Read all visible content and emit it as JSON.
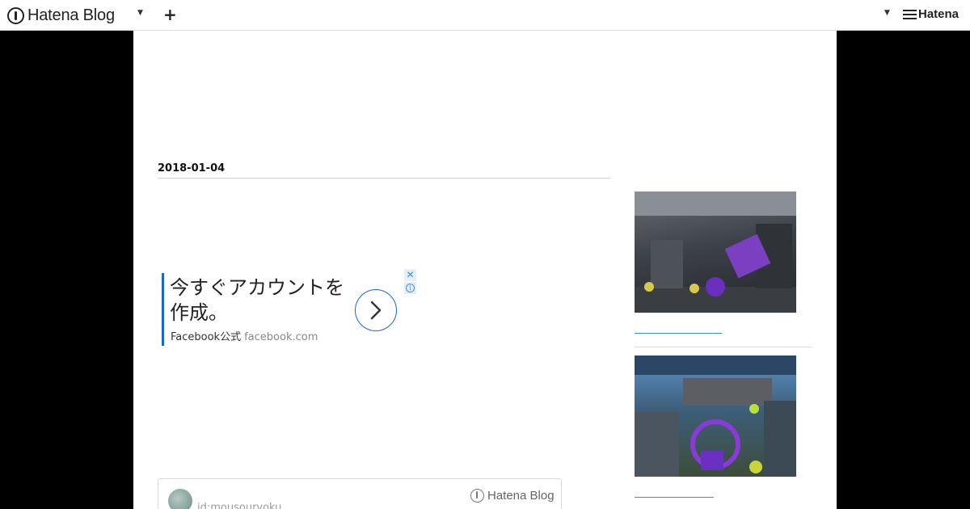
{
  "topbar": {
    "logo_text": "Hatena Blog",
    "left_dropdown_icon": "caret-down-icon",
    "add_icon": "plus-icon",
    "plus_glyph": "+",
    "right_dropdown_icon": "caret-down-icon",
    "brand_text": "Hatena"
  },
  "post": {
    "date": "2018-01-04"
  },
  "ad": {
    "title": "今すぐアカウントを作成。",
    "sponsor": "Facebook公式",
    "domain": "facebook.com",
    "close_glyph": "✕",
    "info_glyph": "i",
    "accent_color": "#1a66c9"
  },
  "author_card": {
    "user_id": "id:mousouryoku",
    "brand_text": "Hatena Blog"
  },
  "sidebar": {
    "thumbnails": [
      {
        "alt": "",
        "icon": "game-screenshot-image"
      },
      {
        "alt": "",
        "icon": "game-screenshot-image"
      }
    ]
  }
}
